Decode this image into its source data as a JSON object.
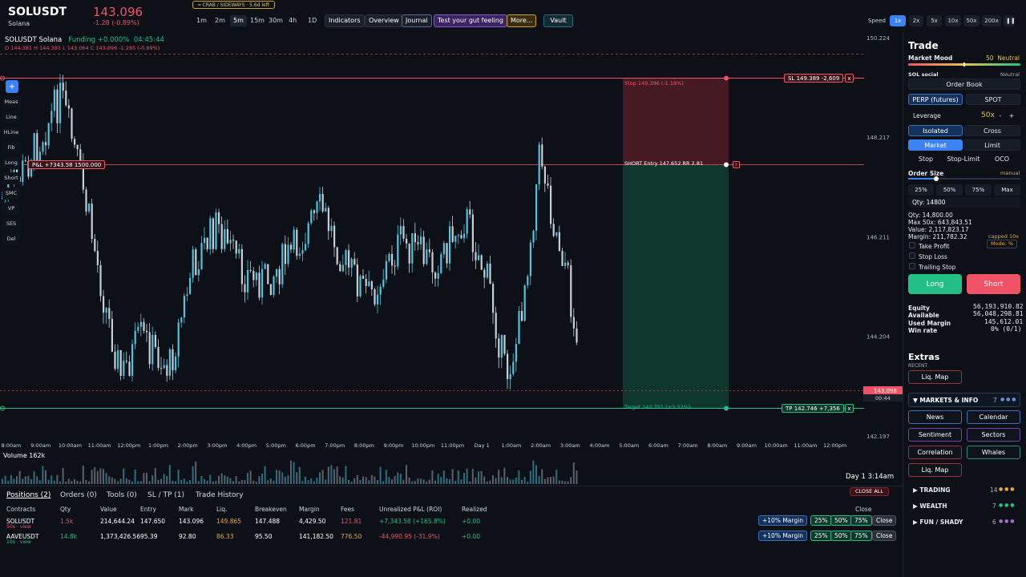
{
  "header": {
    "symbol": "SOLUSDT",
    "name": "Solana",
    "price": "143.096",
    "change": "-1.28 (-0.89%)",
    "regime": "━ CRAB / SIDEWAYS · 5.6d left",
    "timeframes": [
      "1m",
      "2m",
      "5m",
      "15m",
      "30m",
      "4h",
      "1D"
    ],
    "active_tf": "5m",
    "buttons": {
      "indicators": "Indicators",
      "overview": "Overview",
      "journal": "Journal",
      "gut": "Test your gut feeling",
      "more": "More...",
      "vault": "Vault"
    },
    "speed_label": "Speed",
    "speeds": [
      "1x",
      "2x",
      "5x",
      "10x",
      "50x",
      "200x"
    ],
    "pause": "❚❚"
  },
  "chart": {
    "info": "SOLUSDT  Solana",
    "funding": "Funding +0.000%",
    "timer": "04:45:44",
    "ohlc": {
      "o": "O 144.381",
      "h": "H 144.381",
      "l": "L 143.064",
      "c": "C 143.096",
      "chg": "-1.285 (-0.89%)"
    },
    "tools": [
      "Meas",
      "Line",
      "HLine",
      "Fib",
      "Long",
      "Short",
      "SMC",
      "VP",
      "SES",
      "Del"
    ],
    "add": "+",
    "price_ticks": [
      "150.224",
      "148.217",
      "146.211",
      "144.204",
      "142.197"
    ],
    "last_price": "143.096",
    "last_timer": "00:44",
    "time_ticks": [
      "8:00am",
      "9:00am",
      "10:00am",
      "11:00am",
      "12:00pm",
      "1:00pm",
      "2:00pm",
      "3:00pm",
      "4:00pm",
      "5:00pm",
      "6:00pm",
      "7:00pm",
      "8:00pm",
      "9:00pm",
      "10:00pm",
      "11:00pm",
      "Day 1",
      "1:00am",
      "2:00am",
      "3:00am",
      "4:00am",
      "5:00am",
      "6:00am",
      "7:00am",
      "8:00am",
      "9:00am",
      "10:00am",
      "11:00am",
      "12:00pm"
    ],
    "volume_label": "Volume  162k",
    "day_label": "Day 1  3:14am",
    "pnl_tag": "P&L +7343.58  1500.000",
    "sl_tag": "SL 149.389  -2,609",
    "tp_tag": "TP 142.746  +7,356",
    "x": "x",
    "stop_label": "Stop 149.396 (-1.18%)",
    "entry_label": "SHORT  Entry 147.652   RR 2.81",
    "target_label": "Target 142.751 (+3.32%)"
  },
  "bottom": {
    "tabs": [
      "Positions (2)",
      "Orders (0)",
      "Tools (0)",
      "SL / TP (1)",
      "Trade History"
    ],
    "close_all": "CLOSE ALL",
    "headers": [
      "Contracts",
      "Qty",
      "Value",
      "Entry",
      "Mark",
      "Liq.",
      "Breakeven",
      "Margin",
      "Fees",
      "Unrealized P&L (ROI)",
      "Realized",
      "Close"
    ],
    "rows": [
      {
        "contract": "SOLUSDT",
        "sub": "50x · view",
        "qty": "1.5k",
        "value": "214,644.24",
        "entry": "147.650",
        "mark": "143.096",
        "liq": "149.865",
        "breakeven": "147.488",
        "margin": "4,429.50",
        "fees": "121.81",
        "upnl": "+7,343.58 (+165.8%)",
        "realized": "+0.00"
      },
      {
        "contract": "AAVEUSDT",
        "sub": "10x · view",
        "qty": "14.8k",
        "value": "1,373,426.56",
        "entry": "95.39",
        "mark": "92.80",
        "liq": "86.33",
        "breakeven": "95.50",
        "margin": "141,182.50",
        "fees": "776.50",
        "upnl": "-44,990.95 (-31.9%)",
        "realized": "+0.00"
      }
    ],
    "margin_btn": "+10% Margin",
    "pcts": [
      "25%",
      "50%",
      "75%"
    ],
    "close_btn": "Close"
  },
  "side": {
    "title": "Trade",
    "mood_label": "Market Mood",
    "mood_value": "50",
    "mood_text": "Neutral",
    "mood_level": 0.5,
    "social_label": "SOL social",
    "social_value": "Neutral",
    "order_book": "Order Book",
    "perp": "PERP (futures)",
    "spot": "SPOT",
    "leverage_label": "Leverage",
    "leverage_value": "50x",
    "minus": "-",
    "plus": "+",
    "isolated": "Isolated",
    "cross": "Cross",
    "market": "Market",
    "limit": "Limit",
    "stop": "Stop",
    "stop_limit": "Stop-Limit",
    "oco": "OCO",
    "order_size": "Order Size",
    "manual": "manual",
    "size_level": 0.25,
    "sizes": [
      "25%",
      "50%",
      "75%",
      "Max"
    ],
    "qty_input": "Qty: 14800",
    "qty": "Qty: 14,800.00",
    "max": "Max 50x: 643,843.51",
    "value": "Value: 2,117,823.17",
    "margin": "Margin: 211,782.32",
    "capped": "capped 10x",
    "mode": "Mode: %",
    "take_profit": "Take Profit",
    "stop_loss": "Stop Loss",
    "trailing": "Trailing Stop",
    "long": "Long",
    "short": "Short",
    "equity_label": "Equity",
    "equity": "56,193,910.82",
    "available_label": "Available",
    "available": "56,048,298.81",
    "used_label": "Used Margin",
    "used": "145,612.01",
    "win_label": "Win rate",
    "win": "0% (0/1)",
    "extras": "Extras",
    "recent": "RECENT",
    "liq_map": "Liq. Map",
    "markets_info": "▼  MARKETS & INFO",
    "markets_count": "7",
    "grid": [
      "News",
      "Calendar",
      "Sentiment",
      "Sectors",
      "Correlation",
      "Whales",
      "Liq. Map"
    ],
    "sections": [
      {
        "name": "▶  TRADING",
        "count": "14"
      },
      {
        "name": "▶  WEALTH",
        "count": "7"
      },
      {
        "name": "▶  FUN / SHADY",
        "count": "6"
      }
    ],
    "dots": "● ● ●"
  },
  "colors": {
    "up": "#4fc3dc",
    "down": "#c9cdd6",
    "red": "#f05366",
    "green": "#22c087",
    "blue": "#3b82f6"
  }
}
